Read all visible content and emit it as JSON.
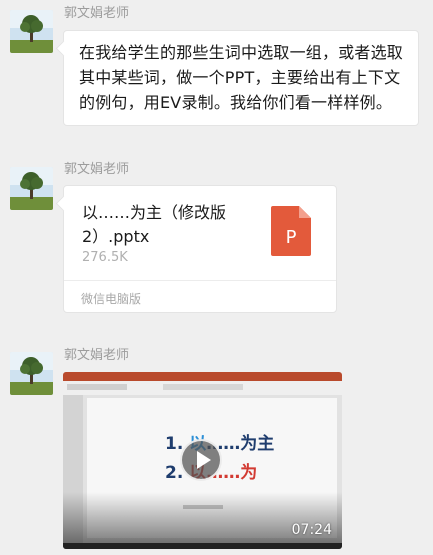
{
  "messages": [
    {
      "type": "text",
      "sender": "郭文娟老师",
      "text": "在我给学生的那些生词中选取一组，或者选取其中某些词，做一个PPT，主要给出有上下文的例句，用EV录制。我给你们看一样样例。"
    },
    {
      "type": "file",
      "sender": "郭文娟老师",
      "file_name": "以……为主（修改版2）.pptx",
      "file_size": "276.5K",
      "file_icon_letter": "P",
      "source": "微信电脑版"
    },
    {
      "type": "video",
      "sender": "郭文娟老师",
      "slide_line1_num": "1. ",
      "slide_line1_word": "以",
      "slide_line1_rest": "……为主",
      "slide_line2_num": "2. ",
      "slide_line2_word": "以",
      "slide_line2_rest": "……为",
      "duration": "07:24"
    }
  ],
  "colors": {
    "background": "#efefef",
    "bubble": "#ffffff",
    "sender": "#9c9c9c",
    "ppt_icon": "#e35a3b"
  },
  "icons": {
    "avatar": "tree-landscape-avatar",
    "file": "ppt-file-icon",
    "play": "play-icon"
  }
}
